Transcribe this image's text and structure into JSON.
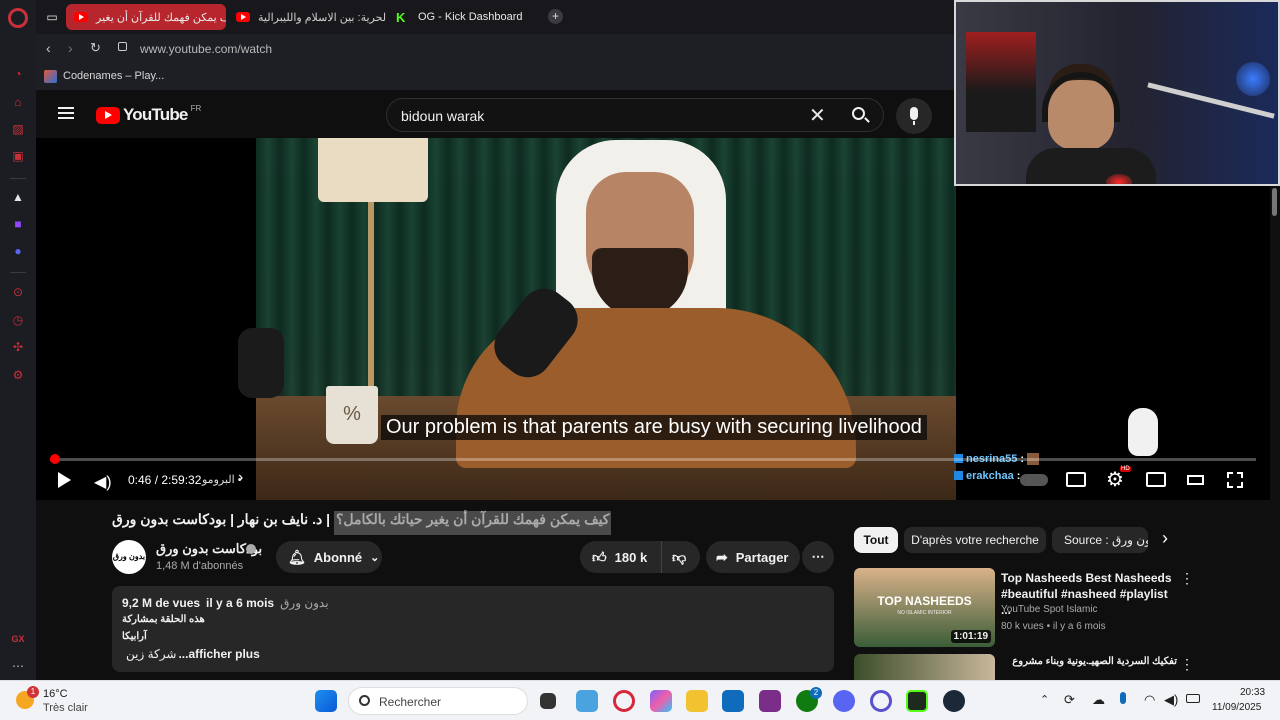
{
  "tabs": [
    {
      "label": "كيف يمكن فهمك للقرآن أن يغير"
    },
    {
      "label": "الحرية: بين الاسلام والليبرالية"
    },
    {
      "label": "OG - Kick Dashboard"
    }
  ],
  "new_tab_label": "+",
  "address": {
    "url": "www.youtube.com/watch"
  },
  "bookmarks": [
    {
      "label": "Codenames – Play..."
    }
  ],
  "youtube": {
    "logo_text": "YouTube",
    "country_code": "FR",
    "search_value": "bidoun warak"
  },
  "player": {
    "subtitle": "Our problem is that parents are busy with securing livelihood",
    "time": "0:46 / 2:59:32",
    "chapter": "• البرومو",
    "progress_fraction": 0.0043,
    "chat": [
      {
        "user": "nesrina55",
        "sep": ":"
      },
      {
        "user": "erakchaa",
        "sep": ":"
      }
    ],
    "hd_badge": "HD"
  },
  "video": {
    "title_main": "كيف يمكن فهمك للقرآن أن يغير حياتك بالكامل؟",
    "title_rest": "| د. نايف بن نهار | بودكاست بدون ورق",
    "channel_name": "بودكاست بدون ورق",
    "channel_logo": "بدون ورق",
    "subscribers": "1,48 M d'abonnés",
    "subscribe_label": "Abonné",
    "likes": "180 k",
    "share_label": "Partager",
    "more_label": "⋯"
  },
  "description": {
    "views": "9,2 M de vues",
    "age": "il y a 6 mois",
    "channel_tag": "بدون ورق",
    "line1": "هذه الحلقة بمشاركة",
    "line2": "آرابيكا",
    "line3_prefix": "شركة زين",
    "more": "...afficher plus"
  },
  "chips": [
    {
      "label": "Tout"
    },
    {
      "label": "D'après votre recherche"
    },
    {
      "label": "Source : بدون ورق"
    }
  ],
  "recommendations": [
    {
      "title": "Top Nasheeds Best Nasheeds #beautiful #nasheed #playlist ...",
      "channel": "YouTube Spot Islamic",
      "meta": "80 k vues • il y a 6 mois",
      "thumb_text": "TOP NASHEEDS",
      "thumb_sub": "NO ISLAMIC INTERIOR",
      "duration": "1:01:19"
    },
    {
      "title": "تفكيك السردية الصهيـ.يونية وبناء مشروع",
      "channel": "",
      "meta": "",
      "thumb_text": "",
      "thumb_sub": "",
      "duration": ""
    }
  ],
  "taskbar": {
    "weather_temp": "16°C",
    "weather_desc": "Très clair",
    "weather_badge": "1",
    "search_placeholder": "Rechercher",
    "time": "20:33",
    "date": "11/09/2025",
    "xbox_badge": "2"
  },
  "sidebar_footer": "GX",
  "colors": {
    "accent": "#ff0000",
    "opera_red": "#c9303b",
    "yt_bg": "#0f0f0f"
  }
}
